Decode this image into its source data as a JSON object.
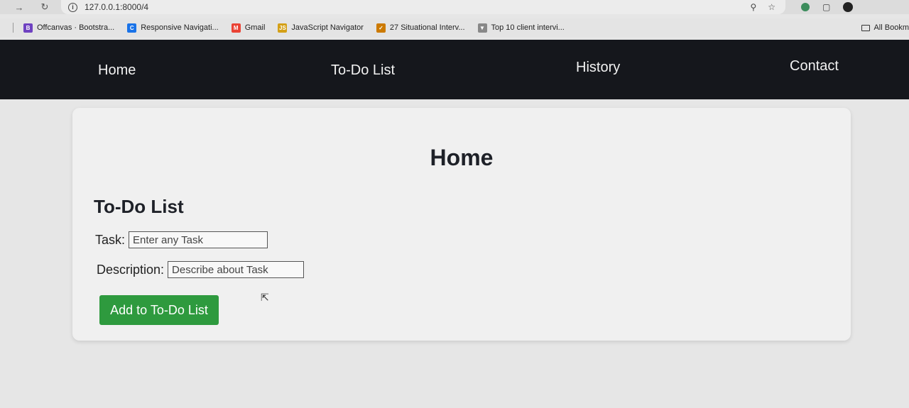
{
  "browser": {
    "url": "127.0.0.1:8000/4",
    "bookmarks": [
      {
        "label": "Offcanvas · Bootstra...",
        "icon": "B",
        "color": "#6f42c1"
      },
      {
        "label": "Responsive Navigati...",
        "icon": "C",
        "color": "#1a73e8"
      },
      {
        "label": "Gmail",
        "icon": "M",
        "color": "#ea4335"
      },
      {
        "label": "JavaScript Navigator",
        "icon": "JS",
        "color": "#d4a017"
      },
      {
        "label": "27 Situational Interv...",
        "icon": "✓",
        "color": "#cc7a00"
      },
      {
        "label": "Top 10 client intervi...",
        "icon": "▼",
        "color": "#888888"
      }
    ],
    "all_bookmarks": "All Bookm"
  },
  "nav": {
    "home": "Home",
    "todo": "To-Do List",
    "history": "History",
    "contact": "Contact"
  },
  "main": {
    "title": "Home",
    "section_title": "To-Do List",
    "task_label": "Task:",
    "task_placeholder": "Enter any Task",
    "desc_label": "Description:",
    "desc_placeholder": "Describe about Task",
    "add_button": "Add to To-Do List"
  },
  "colors": {
    "nav_bg": "#15171c",
    "button_bg": "#2e9a3e",
    "page_bg": "#e6e6e6"
  }
}
